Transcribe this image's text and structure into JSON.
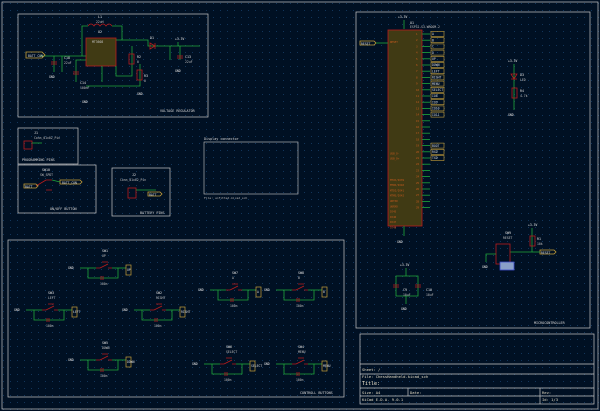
{
  "sections": {
    "voltage_regulator": "VOLTAGE REGULATOR",
    "programming_pins": "PROGRAMMING PINS",
    "onoff_button": "ON/OFF BUTTON",
    "battery_pins": "BATTERY PINS",
    "controll_buttons": "CONTROLL BUTTONS",
    "microcontroller": "MICROCONTROLLER"
  },
  "regulator": {
    "u2_ref": "U2",
    "u2_val": "MT3608",
    "l1_ref": "L1",
    "l1_val": "22uH",
    "c18": "C18",
    "c18_val": "22uF",
    "c14": "C14",
    "c14_val": "100nF",
    "r2": "R2",
    "r3": "R3",
    "r_val": "0",
    "c13": "C13",
    "c13_val": "22uF",
    "batt_net": "BATT_CON",
    "v33": "+3.3V",
    "gnd": "GND",
    "d1": "D1"
  },
  "connectors": {
    "j1_ref": "J1",
    "j1_val": "Conn_01x02_Pin",
    "sw10_ref": "SW10",
    "sw10_val": "SW_SPDT",
    "batt": "BATT",
    "batt_con": "BATT_CON",
    "j2_ref": "J2",
    "j2_val": "Conn_01x02_Pin"
  },
  "display": {
    "title": "Display connector",
    "file": "File: unfitted.kicad_sch"
  },
  "mcu": {
    "u1_ref": "U1",
    "u1_val": "ESP32-S3-WROOM-2",
    "reset": "RESET",
    "pins_right": [
      "A",
      "B",
      "C",
      "D",
      "UP",
      "DOWN",
      "LEFT",
      "RIGHT",
      "MENU",
      "SELECT",
      "IO8",
      "IO9",
      "IO10",
      "IO11",
      "",
      "",
      "",
      "",
      "BOOT",
      "RXD",
      "TXD",
      "",
      "",
      "",
      "",
      "",
      "",
      "",
      ""
    ],
    "pins_left": [
      "RESET",
      "",
      "",
      "",
      "",
      "",
      "",
      "",
      "",
      "",
      "",
      "",
      "",
      "",
      "",
      "",
      "",
      "",
      "",
      "",
      "",
      "USB_D-",
      "USB_D+",
      "",
      "",
      "",
      "MTCK/IO39",
      "MTDO/IO40",
      "MTDI/IO41",
      "MTMS/IO42",
      "U0TXD",
      "U0RXD",
      "IO45",
      "IO46",
      "IO47",
      "IO48",
      ""
    ],
    "v33": "+3.3V",
    "gnd": "GND"
  },
  "led": {
    "v33": "+3.3V",
    "d_ref": "D3",
    "d_val": "LED",
    "r_ref": "R4",
    "r_val": "4.7k",
    "gnd": "GND"
  },
  "reset_circuit": {
    "sw_ref": "SW9",
    "sw_val": "RESET",
    "r_ref": "R1",
    "r_val": "10k",
    "net": "RESET",
    "v33": "+3.3V",
    "gnd": "GND"
  },
  "caps": {
    "v33": "+3.3V",
    "c9": "C9",
    "c9_val": "10uF",
    "c10": "C10",
    "c10_val": "10uF",
    "gnd": "GND"
  },
  "buttons": [
    {
      "ref": "SW1",
      "name": "UP",
      "cap": "100n",
      "gnd": "GND",
      "net": "UP"
    },
    {
      "ref": "SW3",
      "name": "LEFT",
      "cap": "100n",
      "gnd": "GND",
      "net": "LEFT"
    },
    {
      "ref": "SW2",
      "name": "RIGHT",
      "cap": "100n",
      "gnd": "GND",
      "net": "RIGHT"
    },
    {
      "ref": "SW5",
      "name": "DOWN",
      "cap": "100n",
      "gnd": "GND",
      "net": "DOWN"
    },
    {
      "ref": "SW7",
      "name": "A",
      "cap": "100n",
      "gnd": "GND",
      "net": "A"
    },
    {
      "ref": "SW8",
      "name": "B",
      "cap": "100n",
      "gnd": "GND",
      "net": "B"
    },
    {
      "ref": "SW6",
      "name": "SELECT",
      "cap": "100n",
      "gnd": "GND",
      "net": "SELECT"
    },
    {
      "ref": "SW4",
      "name": "MENU",
      "cap": "100n",
      "gnd": "GND",
      "net": "MENU"
    }
  ],
  "title_block": {
    "sheet": "Sheet: /",
    "file": "File: ChessHandheld.kicad_sch",
    "title": "Title:",
    "size": "Size: A4",
    "date": "Date:",
    "kicad": "KiCad E.D.A. 9.0.1",
    "rev": "Rev:",
    "id": "Id: 1/3"
  }
}
